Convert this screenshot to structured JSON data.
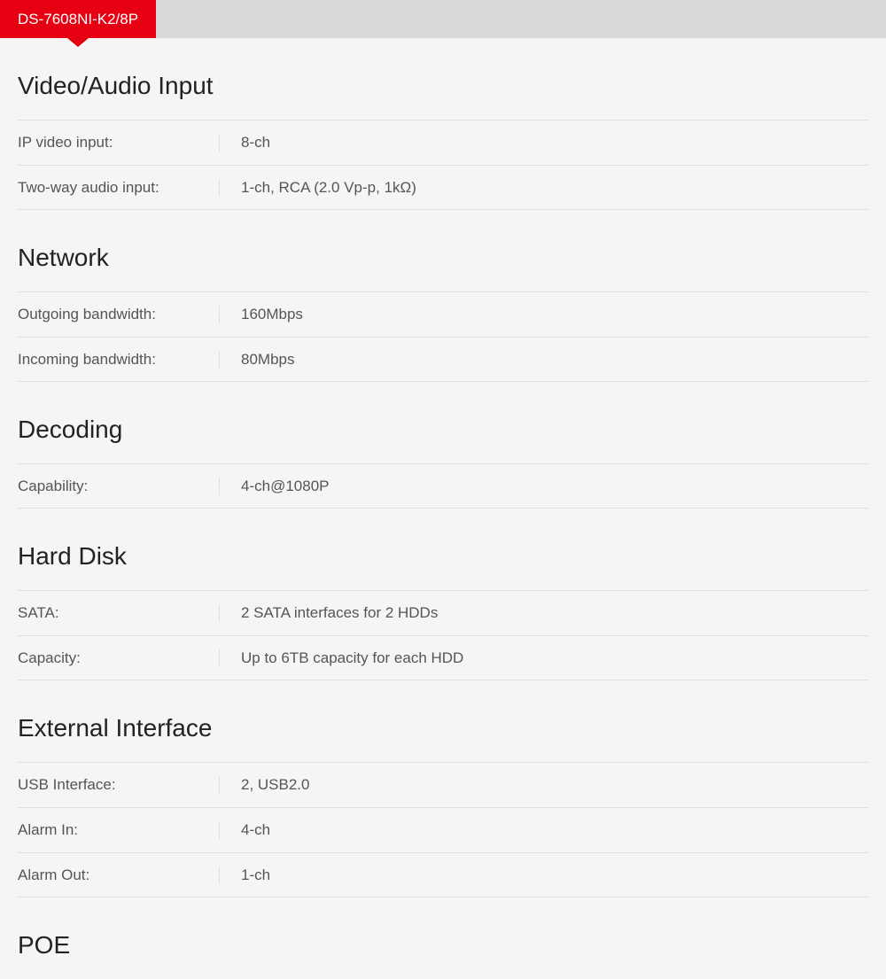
{
  "tab": {
    "label": "DS-7608NI-K2/8P"
  },
  "sections": [
    {
      "title": "Video/Audio Input",
      "rows": [
        {
          "label": "IP video input:",
          "value": "8-ch"
        },
        {
          "label": "Two-way audio input:",
          "value": "1-ch, RCA (2.0 Vp-p, 1kΩ)"
        }
      ]
    },
    {
      "title": "Network",
      "rows": [
        {
          "label": "Outgoing bandwidth:",
          "value": "160Mbps"
        },
        {
          "label": "Incoming bandwidth:",
          "value": "80Mbps"
        }
      ]
    },
    {
      "title": "Decoding",
      "rows": [
        {
          "label": "Capability:",
          "value": "4-ch@1080P"
        }
      ]
    },
    {
      "title": "Hard Disk",
      "rows": [
        {
          "label": "SATA:",
          "value": "2 SATA interfaces for 2 HDDs"
        },
        {
          "label": "Capacity:",
          "value": "Up to 6TB capacity for each HDD"
        }
      ]
    },
    {
      "title": "External Interface",
      "rows": [
        {
          "label": "USB Interface:",
          "value": "2, USB2.0"
        },
        {
          "label": "Alarm In:",
          "value": "4-ch"
        },
        {
          "label": "Alarm Out:",
          "value": "1-ch"
        }
      ]
    },
    {
      "title": "POE",
      "rows": []
    }
  ]
}
